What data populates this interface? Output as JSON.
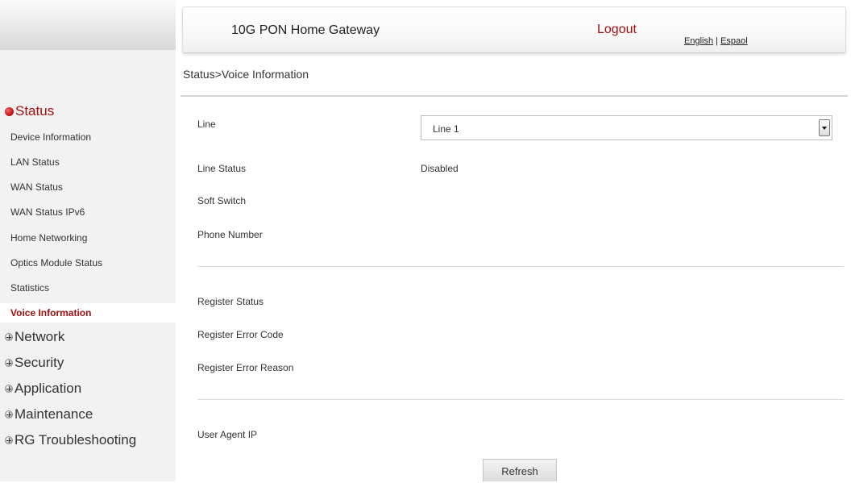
{
  "header": {
    "title": "10G PON Home Gateway",
    "logout": "Logout",
    "lang_english": "English",
    "lang_sep": " | ",
    "lang_espanol": "Espaol"
  },
  "breadcrumb": "Status>Voice Information",
  "sidebar": {
    "status_heading": "Status",
    "status_items": [
      "Device Information",
      "LAN Status",
      "WAN Status",
      "WAN Status IPv6",
      "Home Networking",
      "Optics Module Status",
      "Statistics",
      "Voice Information"
    ],
    "active_item": "Voice Information",
    "sections": [
      "Network",
      "Security",
      "Application",
      "Maintenance",
      "RG Troubleshooting"
    ]
  },
  "form": {
    "line_label": "Line",
    "line_selected": "Line 1",
    "line_status_label": "Line Status",
    "line_status_value": "Disabled",
    "soft_switch_label": "Soft Switch",
    "phone_number_label": "Phone Number",
    "register_status_label": "Register Status",
    "register_error_code_label": "Register Error Code",
    "register_error_reason_label": "Register Error Reason",
    "user_agent_ip_label": "User Agent IP",
    "refresh_button": "Refresh"
  },
  "colors": {
    "accent": "#a50f0f",
    "sidebar_bg": "#f2f2f2"
  }
}
